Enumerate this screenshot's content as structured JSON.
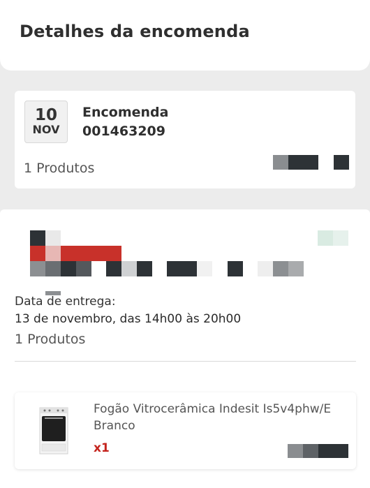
{
  "header": {
    "title": "Detalhes da encomenda"
  },
  "order": {
    "day": "10",
    "month": "NOV",
    "label": "Encomenda",
    "number": "001463209",
    "products_count": "1 Produtos"
  },
  "delivery": {
    "label": "Data de entrega:",
    "date": "13 de novembro, das 14h00 às 20h00",
    "products_count": "1 Produtos"
  },
  "product": {
    "name": "Fogão Vitrocerâmica Indesit Is5v4phw/E Branco",
    "quantity": "x1",
    "image_icon": "stove-icon"
  },
  "colors": {
    "accent_red": "#c4231d",
    "background": "#ececec",
    "card": "#ffffff"
  }
}
